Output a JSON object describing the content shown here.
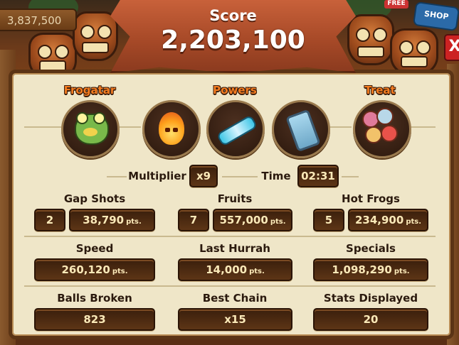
{
  "header": {
    "coins": "3,837,500",
    "score_label": "Score",
    "score_value": "2,203,100",
    "free_badge": "FREE",
    "shop_label": "SHOP",
    "close_label": "X"
  },
  "sections": {
    "frogatar": "Frogatar",
    "powers": "Powers",
    "treat": "Treat"
  },
  "icons": [
    "frog-avatar-icon",
    "fire-power-icon",
    "chain-power-icon",
    "hourglass-power-icon",
    "treat-icon"
  ],
  "multiplier": {
    "label": "Multiplier",
    "value": "x9"
  },
  "time": {
    "label": "Time",
    "value": "02:31"
  },
  "stats": {
    "gap_shots": {
      "label": "Gap Shots",
      "count": "2",
      "points": "38,790"
    },
    "fruits": {
      "label": "Fruits",
      "count": "7",
      "points": "557,000"
    },
    "hot_frogs": {
      "label": "Hot Frogs",
      "count": "5",
      "points": "234,900"
    },
    "speed": {
      "label": "Speed",
      "points": "260,120"
    },
    "last_hurrah": {
      "label": "Last Hurrah",
      "points": "14,000"
    },
    "specials": {
      "label": "Specials",
      "points": "1,098,290"
    },
    "balls_broken": {
      "label": "Balls Broken",
      "value": "823"
    },
    "best_chain": {
      "label": "Best Chain",
      "value": "x15"
    },
    "stats_displayed": {
      "label": "Stats Displayed",
      "value": "20"
    }
  },
  "units": {
    "pts": "pts."
  },
  "colors": {
    "header_orange": "#f47c20",
    "panel_bg": "#efe6c8",
    "box_bg": "#4a2a10",
    "banner": "#b1512b"
  }
}
